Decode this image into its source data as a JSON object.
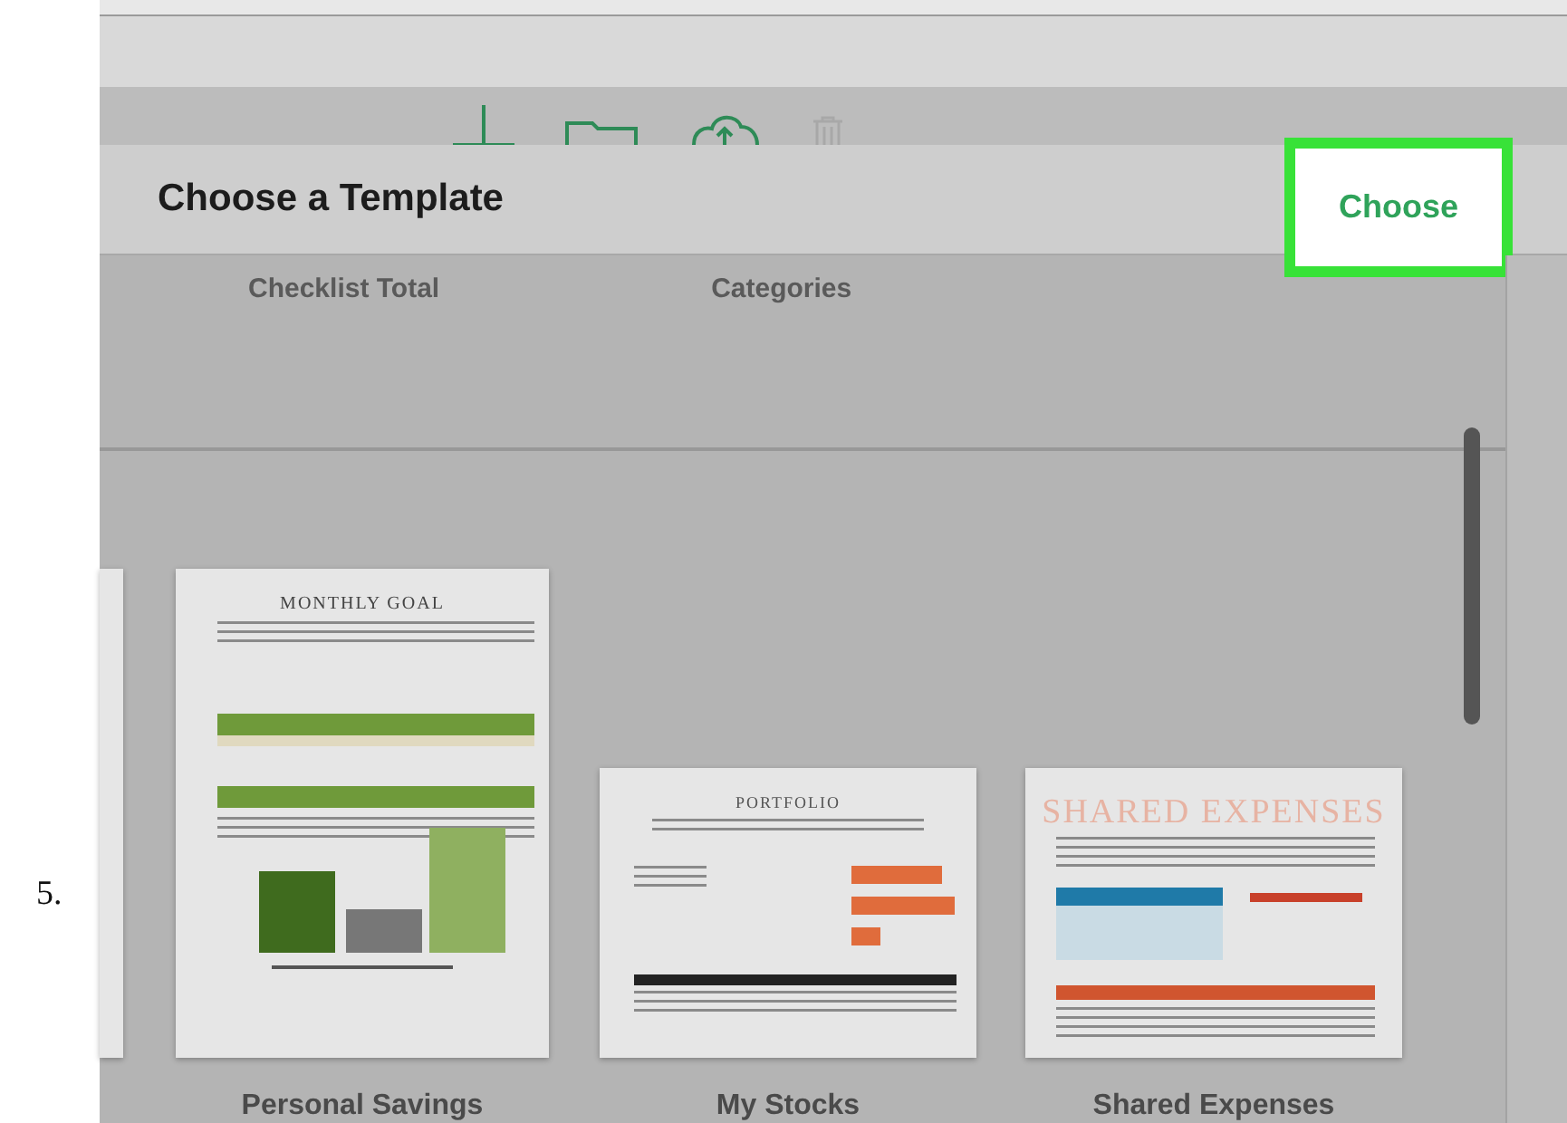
{
  "step_number": "5.",
  "dialog": {
    "title": "Choose a Template",
    "choose_button": "Choose"
  },
  "categories": [
    {
      "label": "Checklist Total"
    },
    {
      "label": "Categories"
    }
  ],
  "templates": [
    {
      "kind": "cut_off"
    },
    {
      "kind": "savings",
      "preview_title": "MONTHLY GOAL",
      "name": "Personal Savings"
    },
    {
      "kind": "stocks",
      "preview_title": "PORTFOLIO",
      "name": "My Stocks"
    },
    {
      "kind": "expenses",
      "preview_title": "SHARED EXPENSES",
      "name": "Shared Expenses"
    }
  ]
}
